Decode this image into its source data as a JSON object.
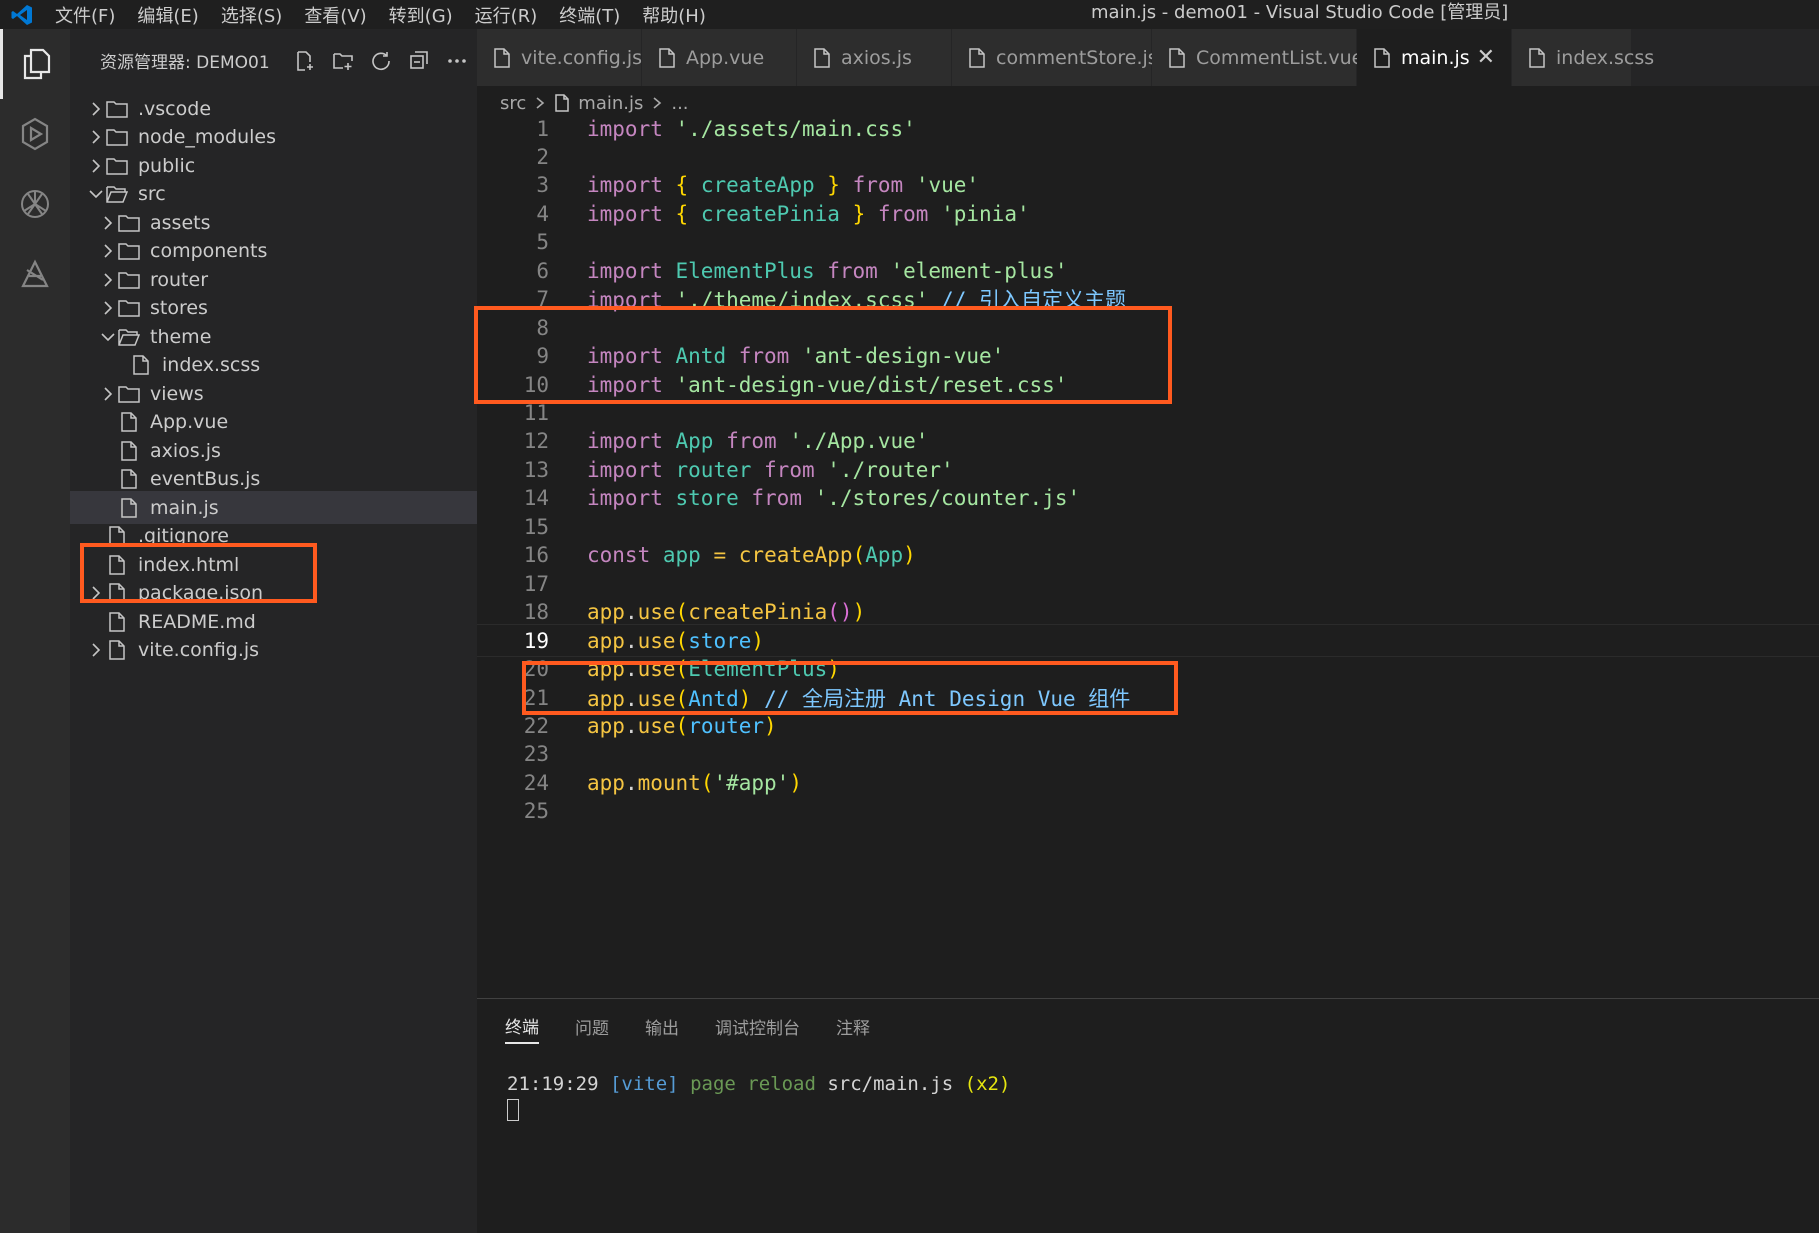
{
  "titlebar": {
    "menu": [
      "文件(F)",
      "编辑(E)",
      "选择(S)",
      "查看(V)",
      "转到(G)",
      "运行(R)",
      "终端(T)",
      "帮助(H)"
    ],
    "title": "main.js - demo01 - Visual Studio Code [管理员]"
  },
  "activity_bar": {
    "icons": [
      "explorer-icon",
      "run-debug-icon",
      "openai-icon",
      "extension-icon"
    ]
  },
  "sidebar": {
    "header": "资源管理器: DEMO01",
    "tree": [
      {
        "label": ".vscode",
        "type": "folder",
        "expanded": false
      },
      {
        "label": "node_modules",
        "type": "folder",
        "expanded": false
      },
      {
        "label": "public",
        "type": "folder",
        "expanded": false
      },
      {
        "label": "src",
        "type": "folder",
        "expanded": true
      },
      {
        "label": "assets",
        "type": "folder",
        "expanded": false
      },
      {
        "label": "components",
        "type": "folder",
        "expanded": false
      },
      {
        "label": "router",
        "type": "folder",
        "expanded": false
      },
      {
        "label": "stores",
        "type": "folder",
        "expanded": false
      },
      {
        "label": "theme",
        "type": "folder",
        "expanded": true
      },
      {
        "label": "index.scss",
        "type": "file"
      },
      {
        "label": "views",
        "type": "folder",
        "expanded": false
      },
      {
        "label": "App.vue",
        "type": "file"
      },
      {
        "label": "axios.js",
        "type": "file"
      },
      {
        "label": "eventBus.js",
        "type": "file"
      },
      {
        "label": "main.js",
        "type": "file",
        "selected": true
      },
      {
        "label": ".gitignore",
        "type": "file"
      },
      {
        "label": "index.html",
        "type": "file"
      },
      {
        "label": "package.json",
        "type": "file"
      },
      {
        "label": "README.md",
        "type": "file"
      },
      {
        "label": "vite.config.js",
        "type": "file"
      }
    ]
  },
  "tabs": [
    {
      "label": "vite.config.js",
      "active": false
    },
    {
      "label": "App.vue",
      "active": false
    },
    {
      "label": "axios.js",
      "active": false
    },
    {
      "label": "commentStore.js",
      "active": false
    },
    {
      "label": "CommentList.vue",
      "active": false
    },
    {
      "label": "main.js",
      "active": true
    },
    {
      "label": "index.scss",
      "active": false
    }
  ],
  "breadcrumb": {
    "folder": "src",
    "file": "main.js",
    "more": "..."
  },
  "editor": {
    "current_line": 19,
    "lines": [
      {
        "n": "1"
      },
      {
        "n": "2"
      },
      {
        "n": "3"
      },
      {
        "n": "4"
      },
      {
        "n": "5"
      },
      {
        "n": "6"
      },
      {
        "n": "7"
      },
      {
        "n": "8"
      },
      {
        "n": "9"
      },
      {
        "n": "10"
      },
      {
        "n": "11"
      },
      {
        "n": "12"
      },
      {
        "n": "13"
      },
      {
        "n": "14"
      },
      {
        "n": "15"
      },
      {
        "n": "16"
      },
      {
        "n": "17"
      },
      {
        "n": "18"
      },
      {
        "n": "19"
      },
      {
        "n": "20"
      },
      {
        "n": "21"
      },
      {
        "n": "22"
      },
      {
        "n": "23"
      },
      {
        "n": "24"
      },
      {
        "n": "25"
      }
    ],
    "tokens": {
      "l1": [
        "import",
        "'./assets/main.css'"
      ],
      "l3": [
        "import",
        "{",
        "createApp",
        "}",
        "from",
        "'vue'"
      ],
      "l4": [
        "import",
        "{",
        "createPinia",
        "}",
        "from",
        "'pinia'"
      ],
      "l6": [
        "import",
        "ElementPlus",
        "from",
        "'element-plus'"
      ],
      "l7": [
        "import",
        "'./theme/index.scss'",
        "// 引入自定义主题"
      ],
      "l9": [
        "import",
        "Antd",
        "from",
        "'ant-design-vue'"
      ],
      "l10": [
        "import",
        "'ant-design-vue/dist/reset.css'"
      ],
      "l12": [
        "import",
        "App",
        "from",
        "'./App.vue'"
      ],
      "l13": [
        "import",
        "router",
        "from",
        "'./router'"
      ],
      "l14": [
        "import",
        "store",
        "from",
        "'./stores/counter.js'"
      ],
      "l16": [
        "const",
        "app",
        "=",
        "createApp",
        "(",
        "App",
        ")"
      ],
      "l18": [
        "app",
        ".",
        "use",
        "(",
        "createPinia",
        "()",
        ")"
      ],
      "l19": [
        "app",
        ".",
        "use",
        "(",
        "store",
        ")"
      ],
      "l20": [
        "app",
        ".",
        "use",
        "(",
        "ElementPlus",
        ")"
      ],
      "l21": [
        "app",
        ".",
        "use",
        "(",
        "Antd",
        ")",
        "// 全局注册 Ant Design Vue 组件"
      ],
      "l22": [
        "app",
        ".",
        "use",
        "(",
        "router",
        ")"
      ],
      "l24": [
        "app",
        ".",
        "mount",
        "(",
        "'#app'",
        ")"
      ]
    }
  },
  "panel": {
    "tabs": [
      "终端",
      "问题",
      "输出",
      "调试控制台",
      "注释"
    ],
    "active_tab": "终端",
    "terminal": {
      "time": "21:19:29",
      "tag": "[vite]",
      "msg": "page reload",
      "path": "src/main.js",
      "count": "(x2)"
    }
  },
  "colors": {
    "highlight_box": "#ff5a1f",
    "keyword": "#c586c0",
    "string": "#ce9178",
    "function": "#dcdcaa",
    "variable": "#4fc1ff"
  }
}
